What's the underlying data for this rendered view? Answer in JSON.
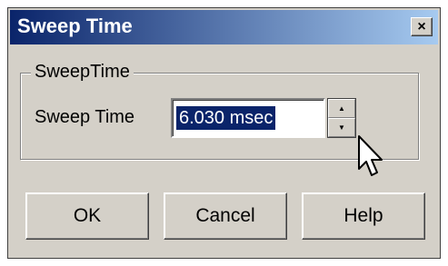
{
  "dialog": {
    "title": "Sweep Time",
    "close_glyph": "×"
  },
  "group": {
    "label": "SweepTime",
    "field_label": "Sweep Time",
    "field_value": "6.030 msec"
  },
  "spinner": {
    "up_glyph": "▲",
    "down_glyph": "▼"
  },
  "buttons": {
    "ok": "OK",
    "cancel": "Cancel",
    "help": "Help"
  },
  "colors": {
    "title_start": "#0a246a",
    "title_end": "#a6caf0",
    "face": "#d4d0c8",
    "selection": "#0a246a"
  },
  "icons": {
    "cursor": "mouse-pointer-icon",
    "close": "close-icon"
  }
}
